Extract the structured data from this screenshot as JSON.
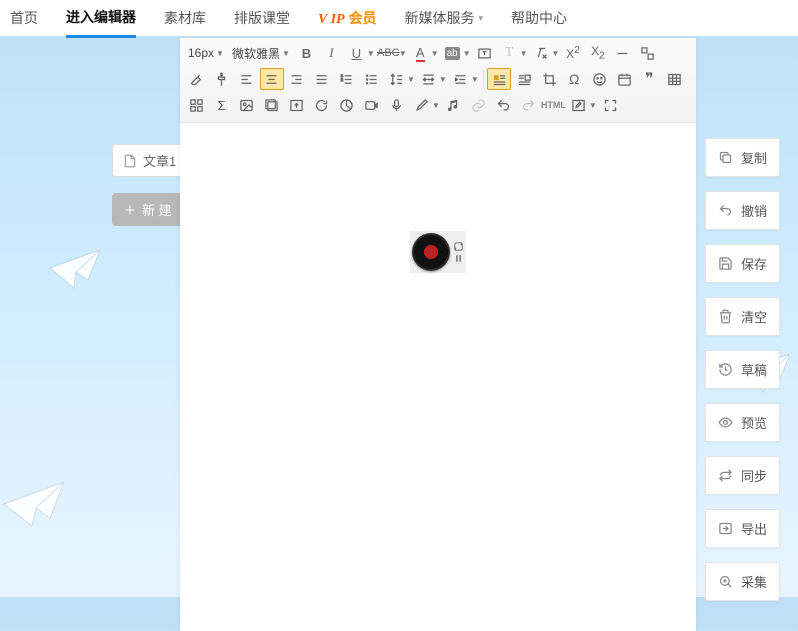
{
  "nav": {
    "home": "首页",
    "editor": "进入编辑器",
    "materials": "素材库",
    "layout": "排版课堂",
    "vip_prefix": "V IP",
    "vip_label": "会员",
    "newmedia": "新媒体服务",
    "help": "帮助中心"
  },
  "left": {
    "doc_tab_label": "文章1",
    "new_btn_label": "新 建"
  },
  "toolbar": {
    "font_size": "16px",
    "font_family": "微软雅黑"
  },
  "right": {
    "copy": "复制",
    "undo": "撤销",
    "save": "保存",
    "clear": "清空",
    "draft": "草稿",
    "preview": "预览",
    "sync": "同步",
    "export": "导出",
    "collect": "采集"
  }
}
